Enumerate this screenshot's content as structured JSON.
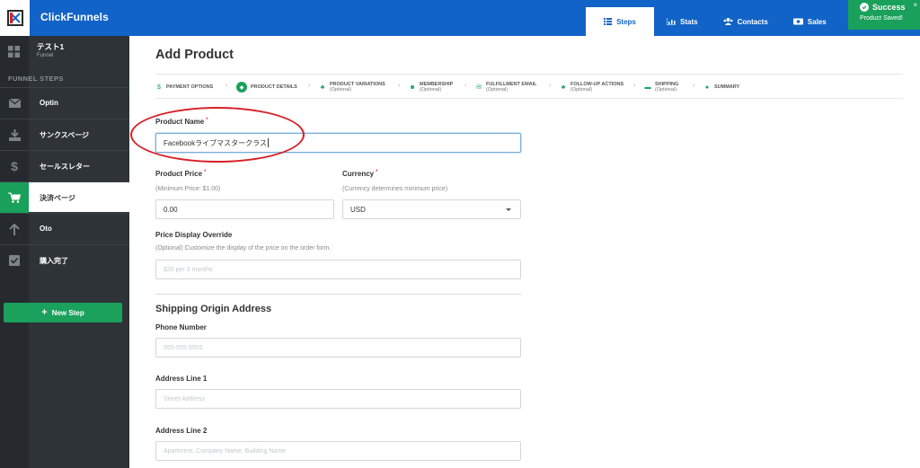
{
  "app": {
    "brand": "ClickFunnels",
    "brand_color": "#1263c7",
    "accent_color": "#19a05b"
  },
  "topnav": [
    {
      "label": "Steps",
      "icon": "list-icon",
      "active": true
    },
    {
      "label": "Stats",
      "icon": "bar-chart-icon"
    },
    {
      "label": "Contacts",
      "icon": "users-icon"
    },
    {
      "label": "Sales",
      "icon": "money-icon"
    }
  ],
  "toast": {
    "title": "Success",
    "message": "Product Saved!",
    "close": "×"
  },
  "sidebar": {
    "funnel_name": "テスト1",
    "funnel_type": "Funnel",
    "steps_label": "FUNNEL STEPS",
    "steps": [
      {
        "label": "Optin",
        "icon": "envelope-icon"
      },
      {
        "label": "サンクスページ",
        "icon": "download-icon"
      },
      {
        "label": "セールスレター",
        "icon": "dollar-icon"
      },
      {
        "label": "決済ページ",
        "icon": "cart-icon",
        "active": true
      },
      {
        "label": "Oto",
        "icon": "arrow-up-icon"
      },
      {
        "label": "購入完了",
        "icon": "checkbox-icon"
      }
    ],
    "new_step": "New Step"
  },
  "page": {
    "title": "Add Product"
  },
  "wizard": [
    {
      "label": "PAYMENT OPTIONS",
      "sub": "",
      "icon": "dollar-icon"
    },
    {
      "label": "PRODUCT DETAILS",
      "sub": "",
      "icon": "tag-icon",
      "active": true
    },
    {
      "label": "PRODUCT VARIATIONS",
      "sub": "(Optional)",
      "icon": "sitemap-icon"
    },
    {
      "label": "MEMBERSHIP",
      "sub": "(Optional)",
      "icon": "users-icon"
    },
    {
      "label": "FULFILLMENT EMAIL",
      "sub": "(Optional)",
      "icon": "envelope-icon"
    },
    {
      "label": "FOLLOW-UP ACTIONS",
      "sub": "(Optional)",
      "icon": "sitemap-icon"
    },
    {
      "label": "SHIPPING",
      "sub": "(Optional)",
      "icon": "truck-icon"
    },
    {
      "label": "SUMMARY",
      "sub": "",
      "icon": "clock-icon"
    }
  ],
  "form": {
    "product_name": {
      "label": "Product Name",
      "value": "Facebookライブマスタークラス"
    },
    "product_price": {
      "label": "Product Price",
      "help": "(Minimum Price: $1.00)",
      "value": "0.00"
    },
    "currency": {
      "label": "Currency",
      "help": "(Currency determines minimum price)",
      "value": "USD"
    },
    "price_override": {
      "label": "Price Display Override",
      "help": "(Optional) Customize the display of the price on the order form.",
      "placeholder": "$20 per 3 months"
    },
    "shipping_section": "Shipping Origin Address",
    "phone": {
      "label": "Phone Number",
      "placeholder": "555-555-5555"
    },
    "address1": {
      "label": "Address Line 1",
      "placeholder": "Street Address"
    },
    "address2": {
      "label": "Address Line 2",
      "placeholder": "Apartment, Company Name, Building Name"
    }
  },
  "required_mark": "*"
}
